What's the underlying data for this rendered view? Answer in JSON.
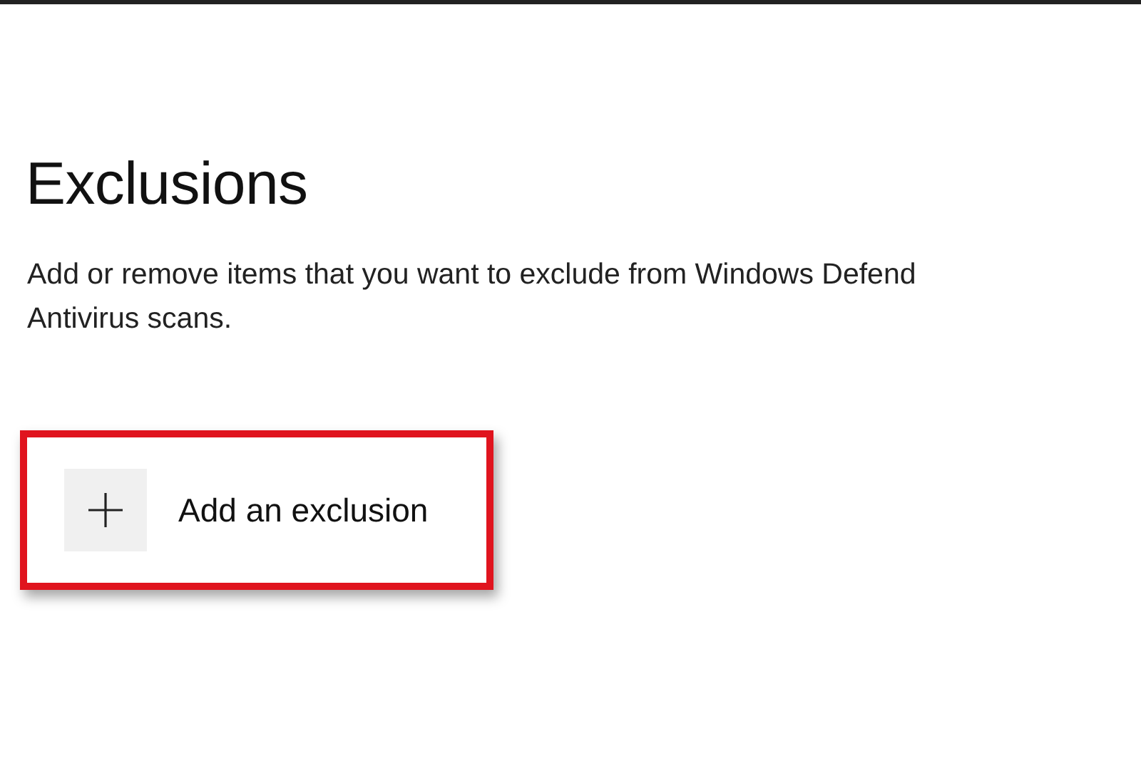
{
  "page": {
    "title": "Exclusions",
    "description": [
      "Add or remove items that you want to exclude from Windows Defend",
      "Antivirus scans."
    ],
    "add_button": {
      "label": "Add an exclusion",
      "highlighted": true
    }
  }
}
